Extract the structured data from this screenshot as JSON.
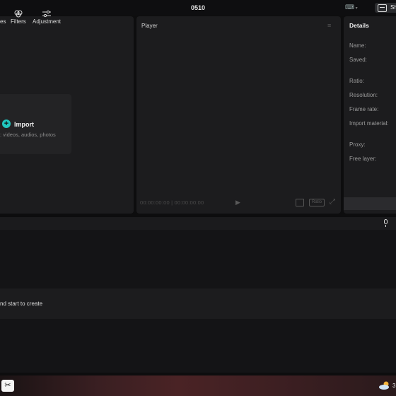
{
  "window": {
    "title": "0510",
    "share_label": "Sh"
  },
  "media_toolbar": {
    "items": [
      {
        "label": "es"
      },
      {
        "label": "Filters"
      },
      {
        "label": "Adjustment"
      }
    ]
  },
  "import": {
    "label": "Import",
    "hint": ": videos, audios, photos"
  },
  "player": {
    "title": "Player",
    "timecode": "00:00:00:00 | 00:00:00:00",
    "ratio_label": "Ratio"
  },
  "details": {
    "title": "Details",
    "labels": [
      "Name:",
      "Saved:",
      "Ratio:",
      "Resolution:",
      "Frame rate:",
      "Import material:",
      "Proxy:",
      "Free layer:"
    ]
  },
  "timeline": {
    "hint": "nd start to create"
  },
  "taskbar": {
    "weather_text": "3"
  }
}
